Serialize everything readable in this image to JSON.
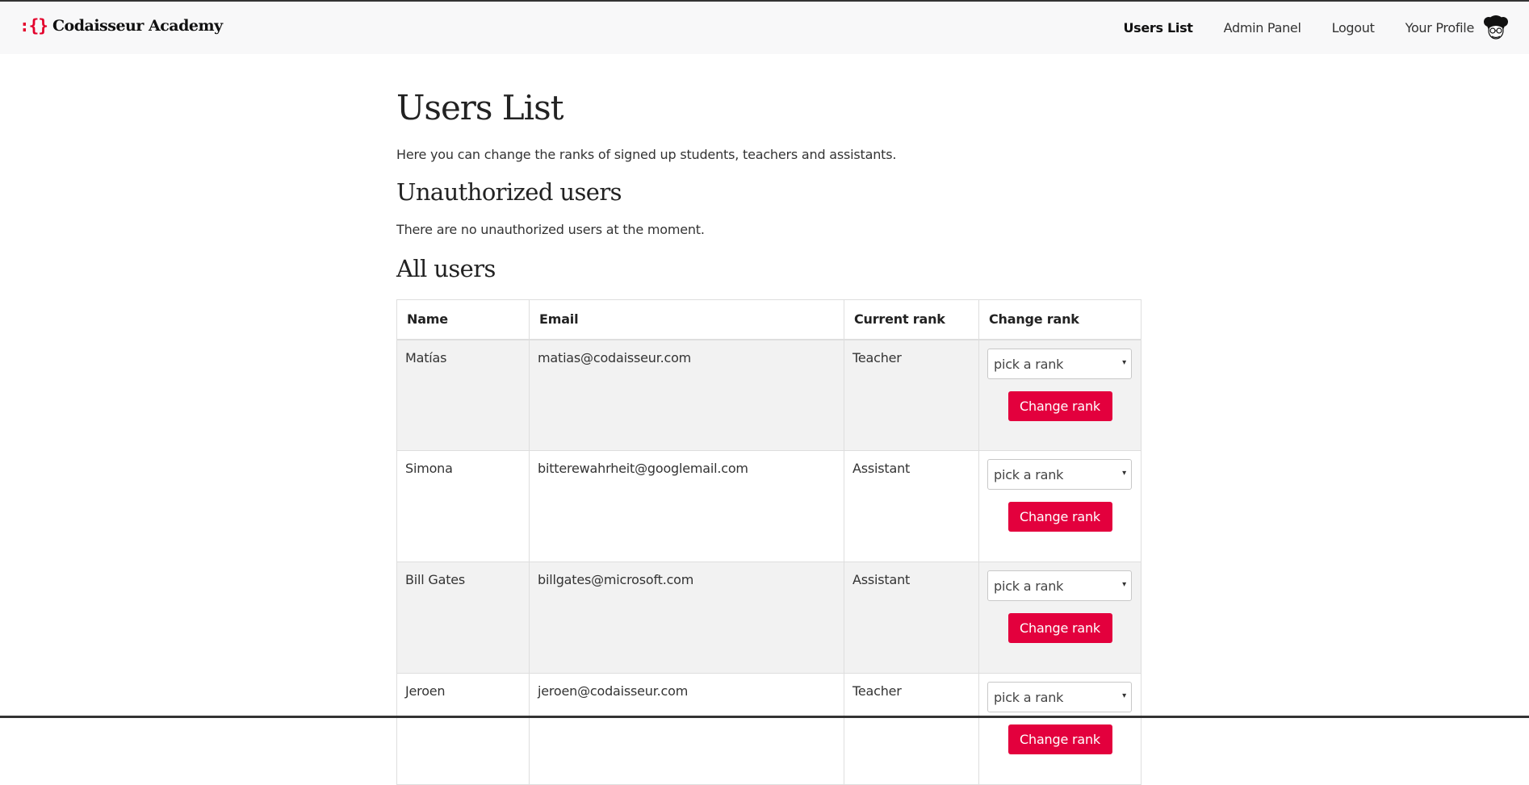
{
  "brand": {
    "mark": ":{}",
    "name": "Codaisseur Academy"
  },
  "nav": {
    "users_list": "Users List",
    "admin_panel": "Admin Panel",
    "logout": "Logout",
    "your_profile": "Your Profile"
  },
  "page": {
    "title": "Users List",
    "intro": "Here you can change the ranks of signed up students, teachers and assistants.",
    "unauthorized_heading": "Unauthorized users",
    "unauthorized_empty": "There are no unauthorized users at the moment.",
    "all_users_heading": "All users"
  },
  "table": {
    "headers": {
      "name": "Name",
      "email": "Email",
      "current_rank": "Current rank",
      "change_rank": "Change rank"
    },
    "rows": [
      {
        "name": "Matías",
        "email": "matias@codaisseur.com",
        "rank": "Teacher",
        "select": "pick a rank",
        "button": "Change rank"
      },
      {
        "name": "Simona",
        "email": "bitterewahrheit@googlemail.com",
        "rank": "Assistant",
        "select": "pick a rank",
        "button": "Change rank"
      },
      {
        "name": "Bill Gates",
        "email": "billgates@microsoft.com",
        "rank": "Assistant",
        "select": "pick a rank",
        "button": "Change rank"
      },
      {
        "name": "Jeroen",
        "email": "jeroen@codaisseur.com",
        "rank": "Teacher",
        "select": "pick a rank",
        "button": "Change rank"
      }
    ]
  },
  "colors": {
    "accent": "#e3003d",
    "brand_mark": "#e3002b",
    "navbar_bg": "#f8f8f9",
    "row_stripe": "#f2f2f2"
  },
  "icons": {
    "avatar": "avatar-icon",
    "select_caret": "caret-down-icon"
  }
}
